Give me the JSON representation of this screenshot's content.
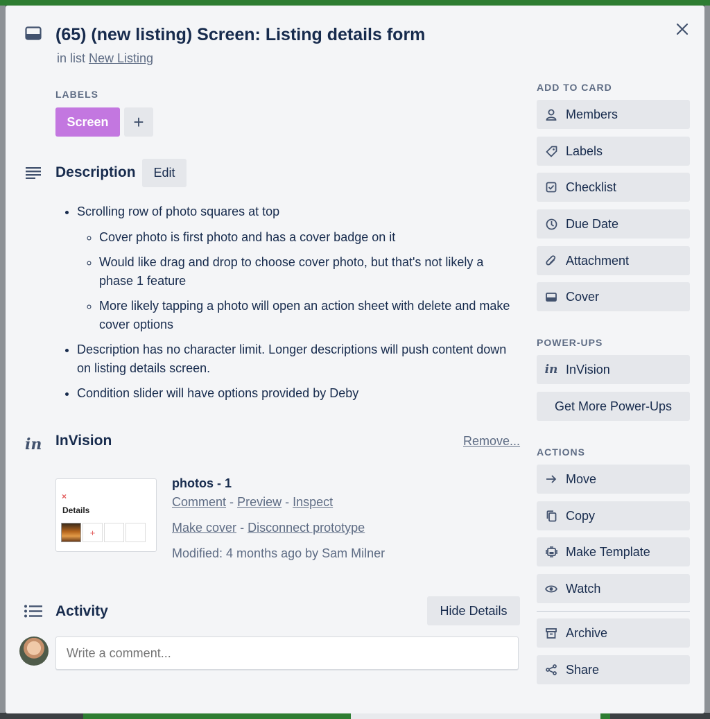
{
  "card": {
    "title": "(65) (new listing) Screen: Listing details form",
    "in_list_prefix": "in list",
    "list_name": "New Listing"
  },
  "labels": {
    "heading": "LABELS",
    "items": [
      {
        "name": "Screen",
        "color": "#c377e0"
      }
    ],
    "add": "+"
  },
  "description": {
    "heading": "Description",
    "edit_label": "Edit",
    "items": [
      "Scrolling row of photo squares at top",
      "Cover photo is first photo and has a cover badge on it",
      "Would like drag and drop to choose cover photo, but that's not likely a phase 1 feature",
      "More likely tapping a photo will open an action sheet with delete and make cover options",
      "Description has no character limit. Longer descriptions will push content down on listing details screen.",
      "Condition slider will have options provided by Deby"
    ]
  },
  "invision": {
    "icon_text": "in",
    "heading": "InVision",
    "remove_label": "Remove...",
    "thumbnail": {
      "close_glyph": "×",
      "title": "Details",
      "plus_glyph": "+"
    },
    "prototype_name": "photos - 1",
    "links_row1": [
      "Comment",
      "Preview",
      "Inspect"
    ],
    "links_row2": [
      "Make cover",
      "Disconnect prototype"
    ],
    "separator": "-",
    "modified": "Modified: 4 months ago by Sam Milner"
  },
  "activity": {
    "heading": "Activity",
    "hide_details_label": "Hide Details",
    "comment_placeholder": "Write a comment..."
  },
  "sidebar": {
    "add_to_card_heading": "ADD TO CARD",
    "add_to_card": [
      "Members",
      "Labels",
      "Checklist",
      "Due Date",
      "Attachment",
      "Cover"
    ],
    "power_ups_heading": "POWER-UPS",
    "power_ups": [
      "InVision",
      "Get More Power-Ups"
    ],
    "actions_heading": "ACTIONS",
    "actions": [
      "Move",
      "Copy",
      "Make Template",
      "Watch",
      "Archive",
      "Share"
    ]
  },
  "colors": {
    "label_purple": "#c377e0",
    "text": "#172b4d",
    "muted": "#5e6c84",
    "button_bg": "#e5e7eb"
  }
}
